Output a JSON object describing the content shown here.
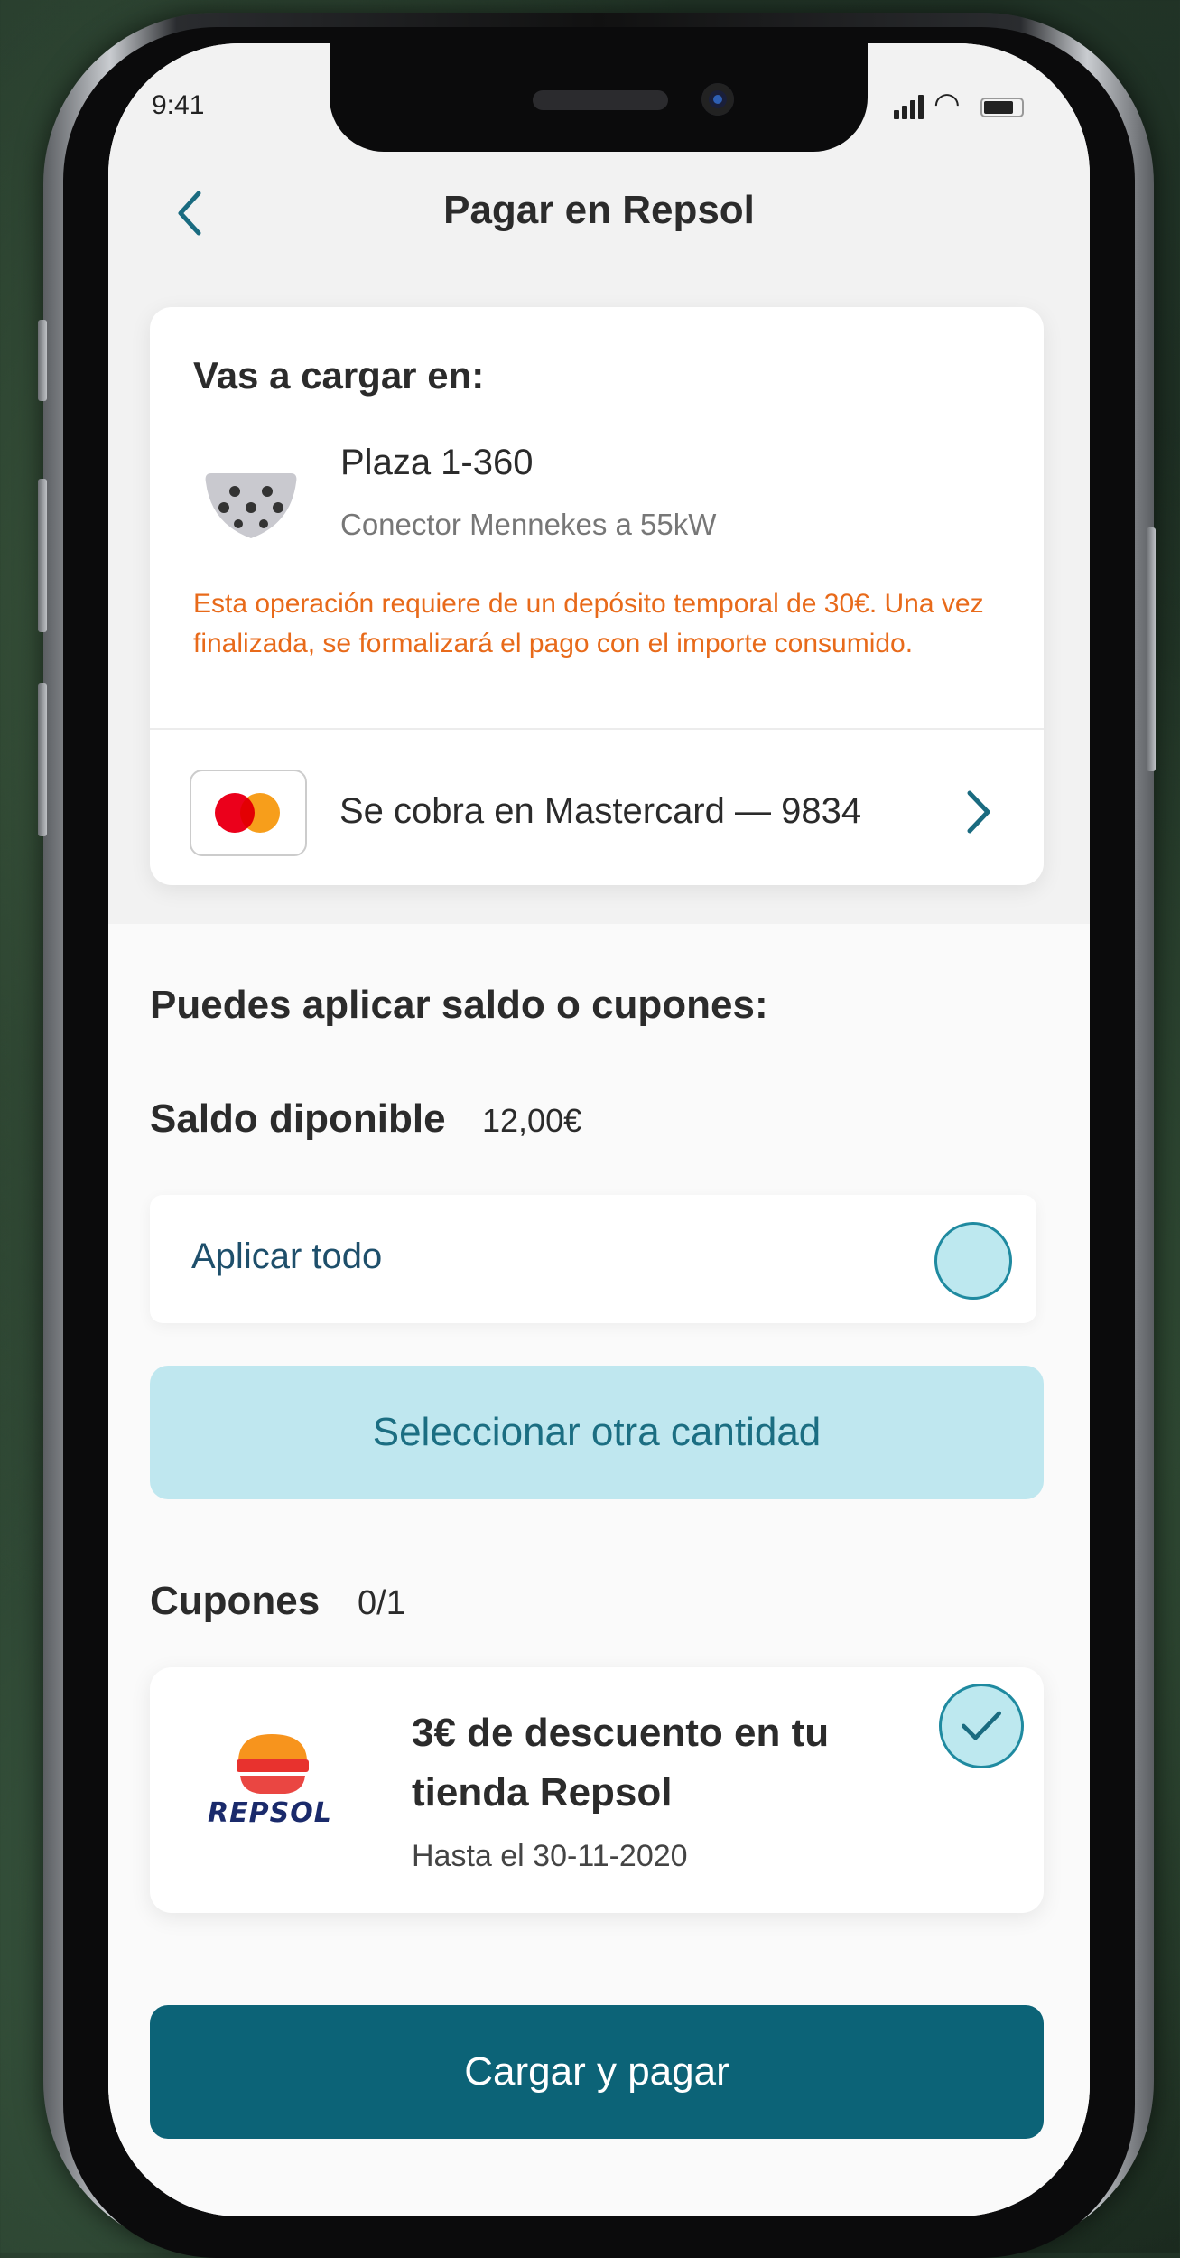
{
  "status_bar": {
    "time": "9:41"
  },
  "header": {
    "title": "Pagar en Repsol",
    "back_icon": "chevron-left-icon"
  },
  "charge_card": {
    "heading": "Vas a cargar en:",
    "spot": "Plaza 1-360",
    "connector": "Conector Mennekes a 55kW",
    "notice": "Esta operación requiere de un depósito temporal de 30€. Una vez finalizada, se formalizará el pago con el importe consumido.",
    "payment_method": "Se cobra en Mastercard — 9834"
  },
  "balance": {
    "section_title": "Puedes aplicar saldo o cupones:",
    "label": "Saldo diponible",
    "value": "12,00€",
    "apply_all": "Aplicar todo",
    "apply_all_selected": false,
    "select_other_button": "Seleccionar otra cantidad"
  },
  "coupons": {
    "label": "Cupones",
    "count": "0/1",
    "items": [
      {
        "brand": "REPSOL",
        "title": "3€ de descuento en tu tienda Repsol",
        "valid_until": "Hasta el 30-11-2020",
        "checked": true
      }
    ]
  },
  "primary_button": "Cargar y pagar",
  "colors": {
    "accent": "#0c6377",
    "accent_light": "#bfe7ef",
    "warning": "#e86a1a",
    "link_text": "#1e4f6b"
  }
}
